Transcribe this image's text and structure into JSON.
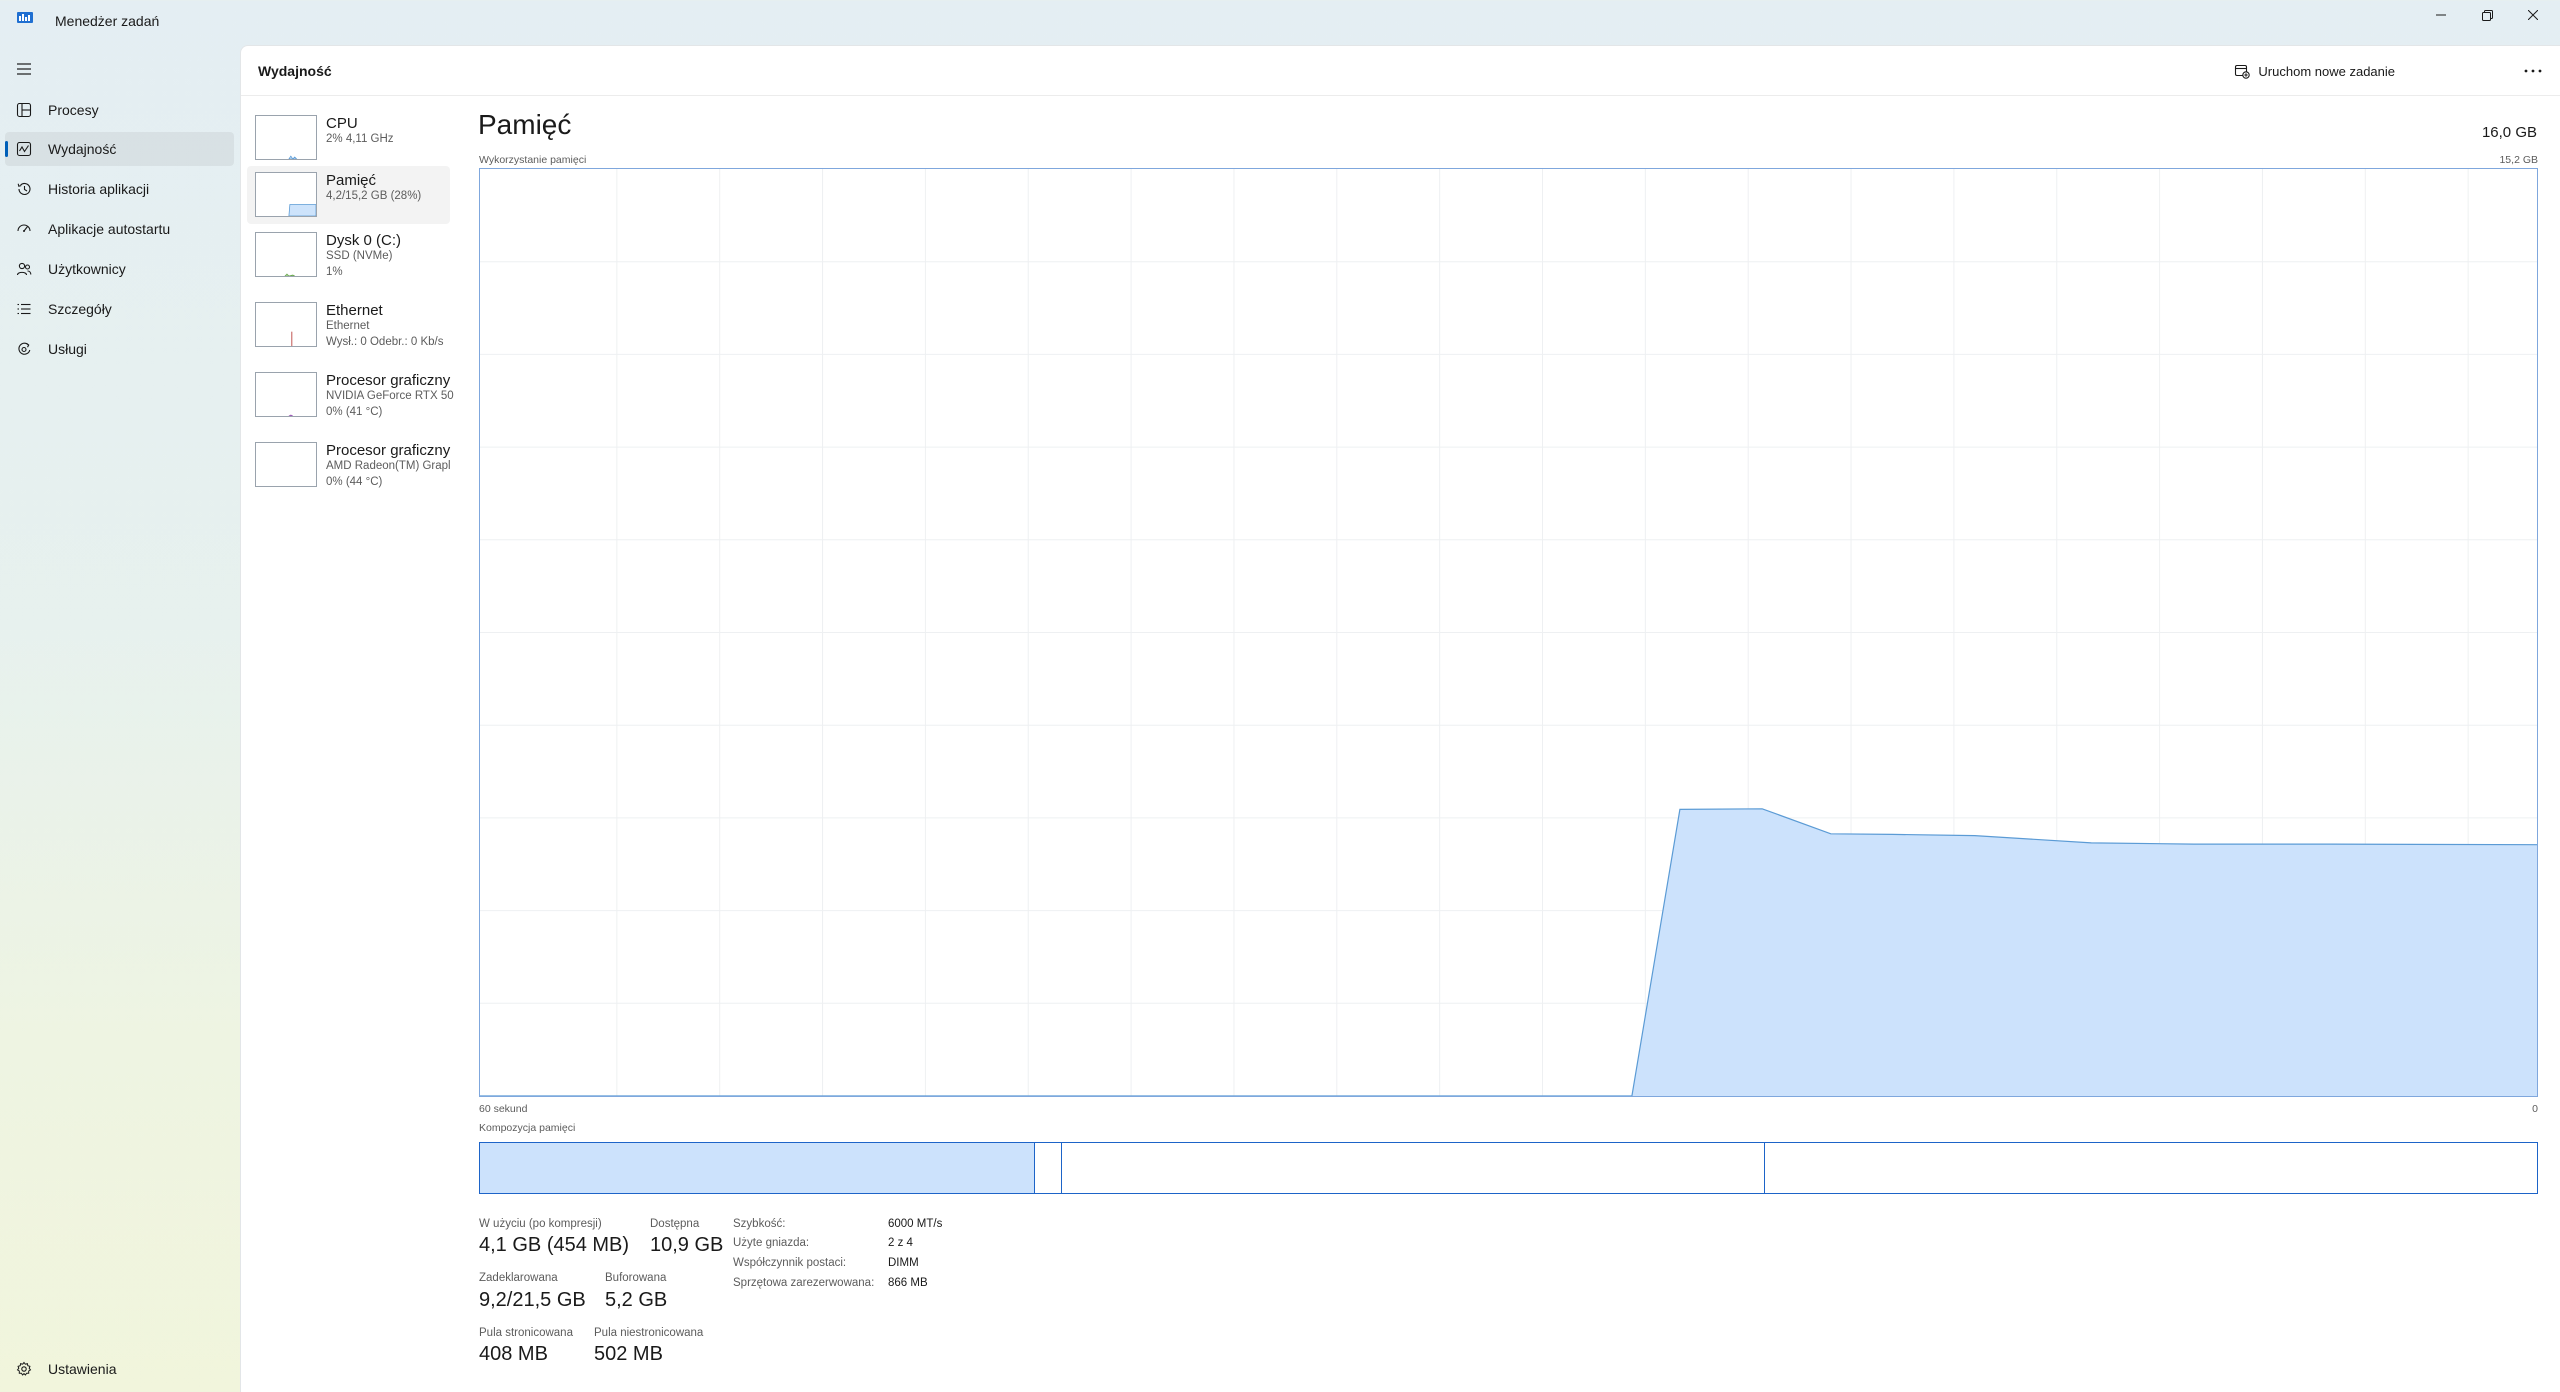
{
  "window": {
    "title": "Menedżer zadań",
    "icons": [
      "app-icon",
      "minimize-icon",
      "restore-icon",
      "close-icon"
    ]
  },
  "nav": {
    "items": [
      {
        "label": "Procesy",
        "icon": "processes-icon"
      },
      {
        "label": "Wydajność",
        "icon": "performance-icon",
        "selected": true
      },
      {
        "label": "Historia aplikacji",
        "icon": "history-icon"
      },
      {
        "label": "Aplikacje autostartu",
        "icon": "startup-icon"
      },
      {
        "label": "Użytkownicy",
        "icon": "users-icon"
      },
      {
        "label": "Szczegóły",
        "icon": "details-icon"
      },
      {
        "label": "Usługi",
        "icon": "services-icon"
      }
    ],
    "settings_label": "Ustawienia"
  },
  "header": {
    "title": "Wydajność",
    "run_task_label": "Uruchom nowe zadanie"
  },
  "devices": [
    {
      "name": "CPU",
      "line1": "2% 4,11 GHz",
      "line2": ""
    },
    {
      "name": "Pamięć",
      "line1": "4,2/15,2 GB (28%)",
      "line2": "",
      "selected": true
    },
    {
      "name": "Dysk 0 (C:)",
      "line1": "SSD (NVMe)",
      "line2": "1%"
    },
    {
      "name": "Ethernet",
      "line1": "Ethernet",
      "line2": "Wysł.: 0 Odebr.: 0 Kb/s"
    },
    {
      "name": "Procesor graficzny",
      "line1": "NVIDIA GeForce RTX 50",
      "line2": "0% (41 °C)"
    },
    {
      "name": "Procesor graficzny",
      "line1": "AMD Radeon(TM) Grapl",
      "line2": "0% (44 °C)"
    }
  ],
  "memory": {
    "title": "Pamięć",
    "total": "16,0 GB",
    "usage_label": "Wykorzystanie pamięci",
    "usage_max": "15,2 GB",
    "x_left": "60 sekund",
    "x_right": "0",
    "composition_label": "Kompozycja pamięci",
    "stats": {
      "in_use_label": "W użyciu (po kompresji)",
      "in_use_value": "4,1 GB (454 MB)",
      "available_label": "Dostępna",
      "available_value": "10,9 GB",
      "committed_label": "Zadeklarowana",
      "committed_value": "9,2/21,5 GB",
      "cached_label": "Buforowana",
      "cached_value": "5,2 GB",
      "paged_label": "Pula stronicowana",
      "paged_value": "408 MB",
      "nonpaged_label": "Pula niestronicowana",
      "nonpaged_value": "502 MB"
    },
    "hardware": {
      "speed_label": "Szybkość:",
      "speed_value": "6000 MT/s",
      "slots_label": "Użyte gniazda:",
      "slots_value": "2 z 4",
      "form_label": "Współczynnik postaci:",
      "form_value": "DIMM",
      "reserved_label": "Sprzętowa zarezerwowana:",
      "reserved_value": "866 MB"
    }
  },
  "chart_data": {
    "type": "area",
    "xlabel": "",
    "ylabel": "",
    "x_range_seconds": [
      60,
      0
    ],
    "ylim_gb": [
      0,
      15.2
    ],
    "grid": true,
    "x": [
      60,
      26.4,
      25.0,
      22.6,
      20.6,
      18.8,
      16.4,
      13.0,
      10.0,
      6.0,
      0
    ],
    "y": [
      0,
      0,
      4.7,
      4.71,
      4.3,
      4.29,
      4.27,
      4.15,
      4.13,
      4.13,
      4.12
    ],
    "composition_gb": {
      "in_use": 4.1,
      "modified": 0.2,
      "standby": 5.2,
      "free": 5.7
    },
    "colors": {
      "fill": "#cce2fc",
      "stroke": "#5b9bd5",
      "grid": "#eef0f2",
      "border": "#7fa7dd",
      "composition_border": "#1d64c8"
    }
  }
}
